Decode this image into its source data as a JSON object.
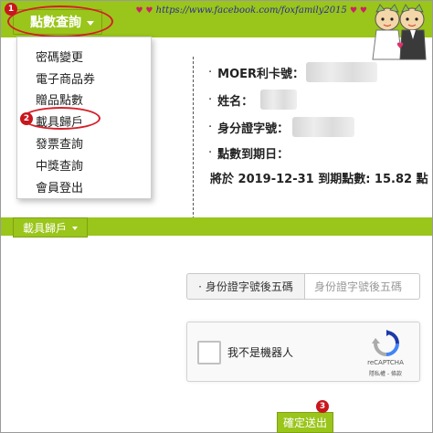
{
  "header": {
    "watermark": "https://www.facebook.com/foxfamily2015",
    "menu_button_label": "點數查詢",
    "step1": "1"
  },
  "dropdown": {
    "items": [
      {
        "label": "密碼變更"
      },
      {
        "label": "電子商品券"
      },
      {
        "label": "贈品點數"
      },
      {
        "label": "載具歸戶"
      },
      {
        "label": "發票查詢"
      },
      {
        "label": "中獎查詢"
      },
      {
        "label": "會員登出"
      }
    ],
    "step2": "2"
  },
  "info": {
    "card_label": "MOER利卡號：",
    "name_label": "姓名：",
    "id_label": "身分證字號：",
    "expiry_label": "點數到期日：",
    "expire_note": "將於 2019-12-31 到期點數: 15.82 點",
    "bullet": "·"
  },
  "section": {
    "button_label": "載具歸戶"
  },
  "form": {
    "addon_bullet": "·",
    "addon_label": "身份證字號後五碼",
    "input_placeholder": "身份證字號後五碼",
    "input_value": ""
  },
  "captcha": {
    "label": "我不是機器人",
    "brand": "reCAPTCHA",
    "links": "隱私權 - 條款"
  },
  "submit": {
    "label": "確定送出",
    "step3": "3"
  },
  "colors": {
    "brand_green": "#9ac51a",
    "highlight_red": "#d4202a"
  }
}
